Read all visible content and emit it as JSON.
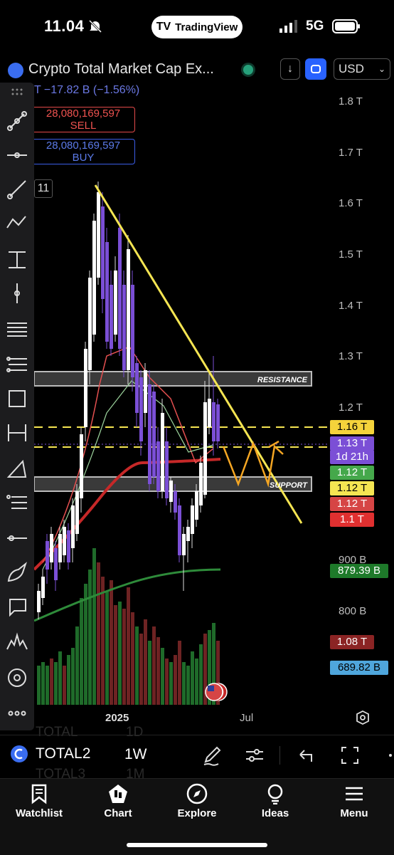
{
  "status_bar": {
    "time": "11.04",
    "network": "5G",
    "pill_label": "TradingView"
  },
  "header": {
    "title": "Crypto Total Market Cap Ex...",
    "currency": "USD",
    "change": "T  −17.82 B (−1.56%)",
    "interval_chip": "11"
  },
  "orders": {
    "sell_price": "28,080,169,597",
    "sell_label": "SELL",
    "buy_price": "28,080,169,597",
    "buy_label": "BUY"
  },
  "chart": {
    "y_ticks": [
      "1.8 T",
      "1.7 T",
      "1.6 T",
      "1.5 T",
      "1.4 T",
      "1.3 T",
      "1.2 T",
      "900 B",
      "800 B"
    ],
    "zone_labels": {
      "resistance": "RESISTANCE",
      "support": "SUPPORT"
    },
    "badges": [
      {
        "text": "1.16 T",
        "bg": "#f5d33b",
        "fg": "#000"
      },
      {
        "text": "1.13 T",
        "bg": "#7b4fd6",
        "fg": "#fff"
      },
      {
        "text": "1d 21h",
        "bg": "#7b4fd6",
        "fg": "#fff"
      },
      {
        "text": "1.12 T",
        "bg": "#45a84b",
        "fg": "#fff"
      },
      {
        "text": "1.12 T",
        "bg": "#f5e552",
        "fg": "#000"
      },
      {
        "text": "1.12 T",
        "bg": "#d64545",
        "fg": "#fff"
      },
      {
        "text": "1.1 T",
        "bg": "#e03030",
        "fg": "#fff"
      },
      {
        "text": "879.39 B",
        "bg": "#1e7a2a",
        "fg": "#fff"
      },
      {
        "text": "1.08 T",
        "bg": "#8b2424",
        "fg": "#fff"
      },
      {
        "text": "689.82 B",
        "bg": "#4fa6dc",
        "fg": "#000"
      }
    ],
    "x_ticks": [
      "2025",
      "Jul"
    ]
  },
  "bottom_toolbar": {
    "symbol": "TOTAL2",
    "interval": "1W",
    "ghost_above_symbol": "TOTAL",
    "ghost_below_symbol": "TOTAL3",
    "ghost_above_interval": "1D",
    "ghost_below_interval": "1M"
  },
  "nav": [
    {
      "label": "Watchlist",
      "icon": "bookmark-icon"
    },
    {
      "label": "Chart",
      "icon": "candles-icon"
    },
    {
      "label": "Explore",
      "icon": "compass-icon"
    },
    {
      "label": "Ideas",
      "icon": "lightbulb-icon"
    },
    {
      "label": "Menu",
      "icon": "hamburger-icon"
    }
  ]
}
